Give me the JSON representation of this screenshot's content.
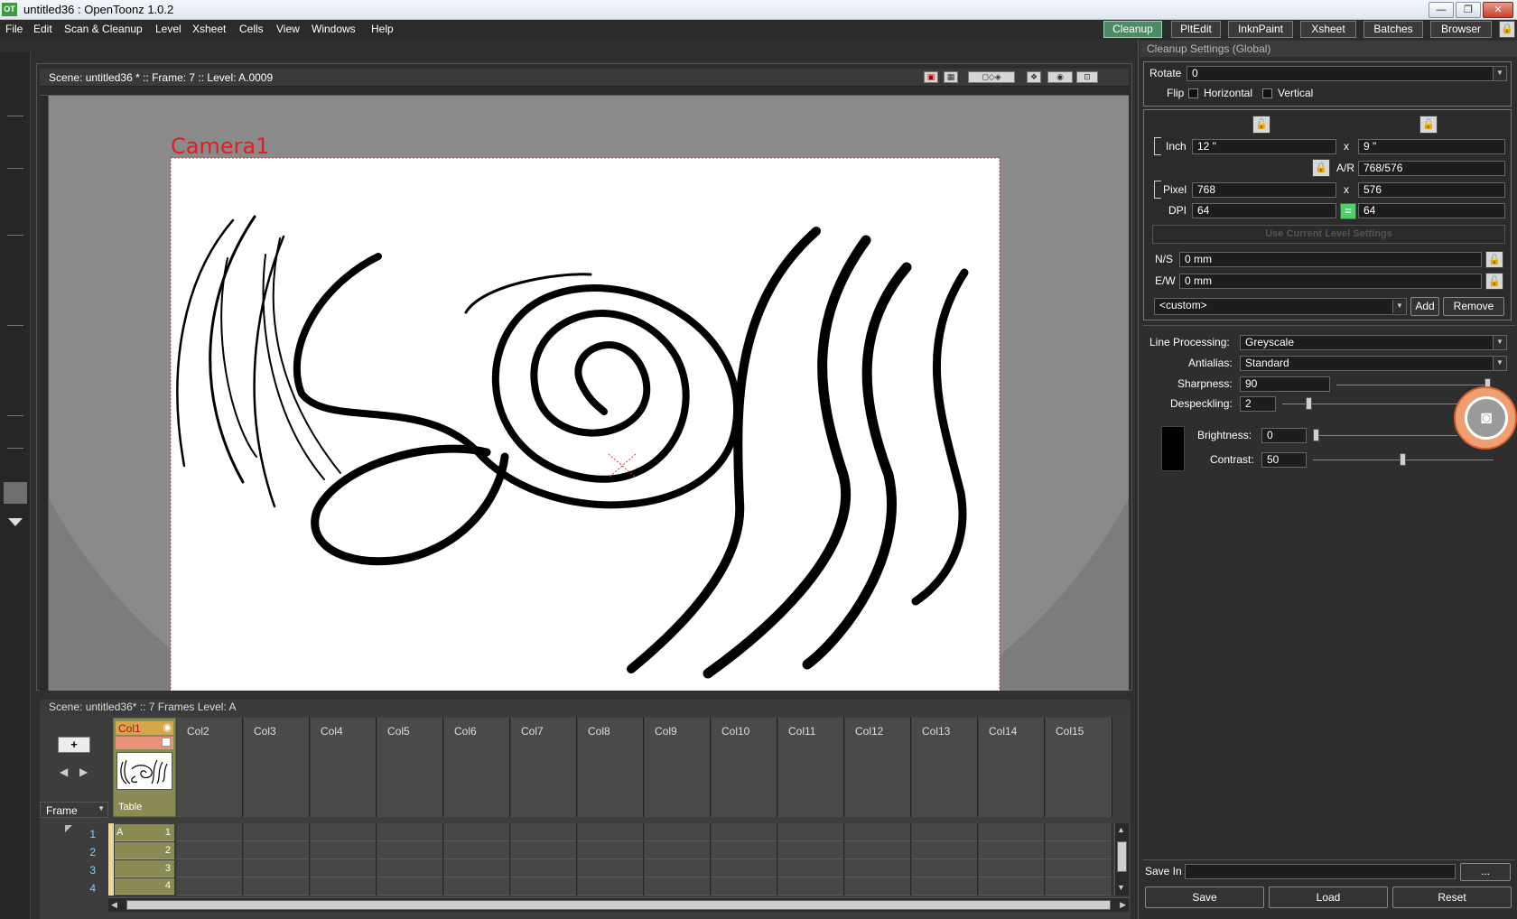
{
  "window": {
    "title": "untitled36 : OpenToonz 1.0.2",
    "app_icon": "OT",
    "minimize": "—",
    "maximize": "❐",
    "close": "✕"
  },
  "menu": [
    "File",
    "Edit",
    "Scan & Cleanup",
    "Level",
    "Xsheet",
    "Cells",
    "View",
    "Windows",
    "Help"
  ],
  "rooms": [
    {
      "label": "Cleanup",
      "active": true
    },
    {
      "label": "PltEdit",
      "active": false
    },
    {
      "label": "InknPaint",
      "active": false
    },
    {
      "label": "Xsheet",
      "active": false
    },
    {
      "label": "Batches",
      "active": false
    },
    {
      "label": "Browser",
      "active": false
    }
  ],
  "viewer": {
    "header": "Scene: untitled36 *  ::  Frame: 7  ::  Level: A.0009",
    "camera_label": "Camera1"
  },
  "xsheet": {
    "header": "Scene: untitled36*  ::  7 Frames  Level: A",
    "frame_label": "Frame",
    "col1_name": "Col1",
    "col1_pegbar": "Table",
    "columns": [
      "Col2",
      "Col3",
      "Col4",
      "Col5",
      "Col6",
      "Col7",
      "Col8",
      "Col9",
      "Col10",
      "Col11",
      "Col12",
      "Col13",
      "Col14",
      "Col15"
    ],
    "rows": [
      "1",
      "2",
      "3",
      "4"
    ],
    "cell_level": "A",
    "cells": [
      "1",
      "2",
      "3",
      "4"
    ]
  },
  "cleanup": {
    "title": "Cleanup Settings (Global)",
    "rotate_label": "Rotate",
    "rotate_value": "0",
    "flip_label": "Flip",
    "flip_horizontal": "Horizontal",
    "flip_vertical": "Vertical",
    "inch_label": "Inch",
    "inch_w": "12 \"",
    "inch_h": "9 \"",
    "x_sep": "x",
    "ar_label": "A/R",
    "ar_value": "768/576",
    "pixel_label": "Pixel",
    "pixel_w": "768",
    "pixel_h": "576",
    "dpi_label": "DPI",
    "dpi_x": "64",
    "dpi_y": "64",
    "use_current_btn": "Use Current Level Settings",
    "ns_label": "N/S",
    "ns_value": "0 mm",
    "ew_label": "E/W",
    "ew_value": "0 mm",
    "preset_value": "<custom>",
    "add_btn": "Add",
    "remove_btn": "Remove",
    "line_processing_label": "Line Processing:",
    "line_processing_value": "Greyscale",
    "antialias_label": "Antialias:",
    "antialias_value": "Standard",
    "sharpness_label": "Sharpness:",
    "sharpness_value": "90",
    "despeckling_label": "Despeckling:",
    "despeckling_value": "2",
    "brightness_label": "Brightness:",
    "brightness_value": "0",
    "contrast_label": "Contrast:",
    "contrast_value": "50",
    "save_in_label": "Save In",
    "browse_btn": "...",
    "save_btn": "Save",
    "load_btn": "Load",
    "reset_btn": "Reset"
  }
}
